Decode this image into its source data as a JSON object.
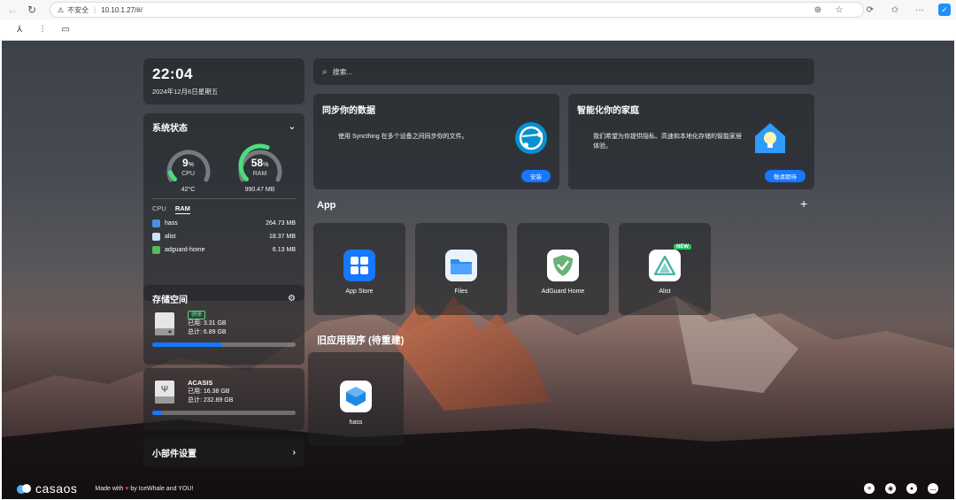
{
  "browser": {
    "security_label": "不安全",
    "url": "10.10.1.27/#/"
  },
  "clock": {
    "time": "22:04",
    "date": "2024年12月6日星期五"
  },
  "system": {
    "title": "系统状态",
    "cpu": {
      "value": "9",
      "unit": "%",
      "label": "CPU",
      "sub": "42°C",
      "percent": 9
    },
    "ram": {
      "value": "58",
      "unit": "%",
      "label": "RAM",
      "sub": "990.47 MB",
      "percent": 58
    },
    "tabs": [
      "CPU",
      "RAM"
    ],
    "processes": [
      {
        "name": "hass",
        "value": "264.73 MB",
        "color": "#4a90e2"
      },
      {
        "name": "alist",
        "value": "18.37 MB",
        "color": "#cfe3f7"
      },
      {
        "name": "adguard-home",
        "value": "6.13 MB",
        "color": "#5cb85c"
      }
    ]
  },
  "storage": {
    "title": "存储空间",
    "disk1": {
      "status": "健康",
      "used": "已用: 3.31 GB",
      "total": "总计: 6.89 GB",
      "fraction": 0.48
    },
    "disk2": {
      "name": "ACASIS",
      "used": "已用: 16.38 GB",
      "total": "总计: 232.89 GB",
      "fraction": 0.07
    }
  },
  "widgets": {
    "label": "小部件设置"
  },
  "search": {
    "placeholder": "搜索..."
  },
  "banners": [
    {
      "title": "同步你的数据",
      "text": "使用 Syncthing 在多个设备之间同步你的文件。",
      "button": "安装"
    },
    {
      "title": "智能化你的家庭",
      "text": "我们希望为你提供隐私、高速和本地化存储的智能家居体验。",
      "button": "敬请期待"
    }
  ],
  "apps_section": {
    "title": "App"
  },
  "apps": [
    {
      "name": "App Store"
    },
    {
      "name": "Files"
    },
    {
      "name": "AdGuard Home"
    },
    {
      "name": "Alist",
      "badge": "NEW"
    }
  ],
  "legacy_section": {
    "title": "旧应用程序 (待重建)"
  },
  "legacy_apps": [
    {
      "name": "hass"
    }
  ],
  "footer": {
    "logo": "casaos",
    "made_with": "Made with",
    "by": "by IceWhale and YOU!"
  },
  "colors": {
    "accent": "#1677ff",
    "ok": "#4ade80",
    "new": "#22c55e"
  }
}
